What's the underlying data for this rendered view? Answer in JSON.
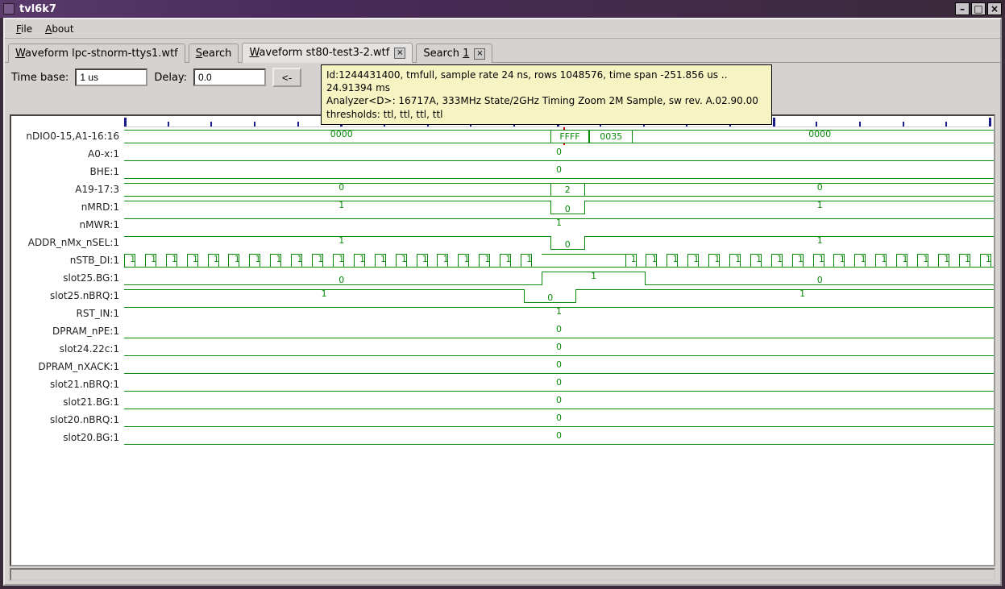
{
  "window": {
    "title": "tvl6k7"
  },
  "menu": {
    "file": "File",
    "about": "About"
  },
  "tabs": {
    "t0": "Waveform lpc-stnorm-ttys1.wtf",
    "t1": "Search",
    "t2": "Waveform st80-test3-2.wtf",
    "t3": "Search 1"
  },
  "toolbar": {
    "timebase_label": "Time base:",
    "timebase_value": "1 us",
    "delay_label": "Delay:",
    "delay_value": "0.0",
    "prev": "<-"
  },
  "tooltip": {
    "line1": "Id:1244431400, tmfull, sample rate 24 ns, rows 1048576, time span -251.856 us .. 24.91394 ms",
    "line2": "Analyzer<D>: 16717A, 333MHz State/2GHz Timing Zoom 2M Sample, sw rev. A.02.90.00",
    "line3": "thresholds: ttl, ttl, ttl, ttl"
  },
  "signals": {
    "s0": {
      "name": "nDIO0-15,A1-16:16",
      "vals": {
        "v1": "0000",
        "v2": "FFFF",
        "v3": "0035",
        "v4": "0000"
      }
    },
    "s1": {
      "name": "A0-x:1",
      "vals": {
        "c": "0"
      }
    },
    "s2": {
      "name": "BHE:1",
      "vals": {
        "c": "0"
      }
    },
    "s3": {
      "name": "A19-17:3",
      "vals": {
        "l": "0",
        "c": "2",
        "r": "0"
      }
    },
    "s4": {
      "name": "nMRD:1",
      "vals": {
        "l": "1",
        "c": "0",
        "r": "1"
      }
    },
    "s5": {
      "name": "nMWR:1",
      "vals": {
        "c": "1"
      }
    },
    "s6": {
      "name": "ADDR_nMx_nSEL:1",
      "vals": {
        "l": "1",
        "c": "0",
        "r": "1"
      }
    },
    "s7": {
      "name": "nSTB_DI:1",
      "vals": {
        "bit": "1"
      }
    },
    "s8": {
      "name": "slot25.BG:1",
      "vals": {
        "l": "0",
        "c": "1",
        "r": "0"
      }
    },
    "s9": {
      "name": "slot25.nBRQ:1",
      "vals": {
        "l": "1",
        "c": "0",
        "r": "1"
      }
    },
    "s10": {
      "name": "RST_IN:1",
      "vals": {
        "c": "1"
      }
    },
    "s11": {
      "name": "DPRAM_nPE:1",
      "vals": {
        "c": "0"
      }
    },
    "s12": {
      "name": "slot24.22c:1",
      "vals": {
        "c": "0"
      }
    },
    "s13": {
      "name": "DPRAM_nXACK:1",
      "vals": {
        "c": "0"
      }
    },
    "s14": {
      "name": "slot21.nBRQ:1",
      "vals": {
        "c": "0"
      }
    },
    "s15": {
      "name": "slot21.BG:1",
      "vals": {
        "c": "0"
      }
    },
    "s16": {
      "name": "slot20.nBRQ:1",
      "vals": {
        "c": "0"
      }
    },
    "s17": {
      "name": "slot20.BG:1",
      "vals": {
        "c": "0"
      }
    }
  }
}
